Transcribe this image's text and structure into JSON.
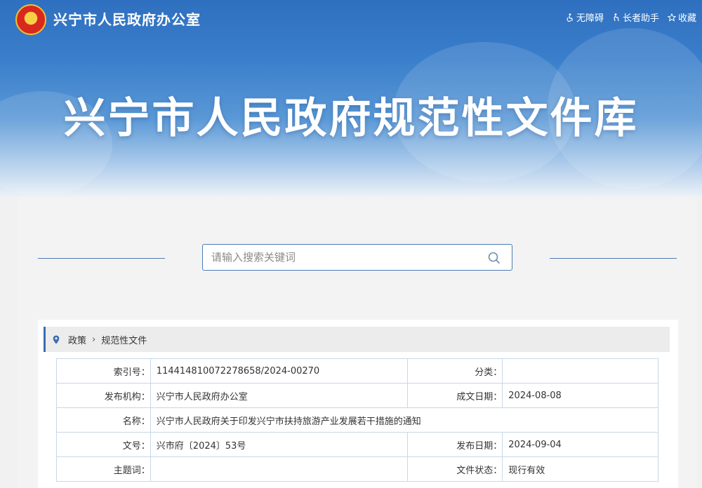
{
  "header": {
    "site_name": "兴宁市人民政府办公室",
    "banner_title": "兴宁市人民政府规范性文件库",
    "links": [
      {
        "icon": "wheelchair-icon",
        "label": "无障碍"
      },
      {
        "icon": "elder-icon",
        "label": "长者助手"
      },
      {
        "icon": "star-icon",
        "label": "收藏"
      }
    ]
  },
  "search": {
    "placeholder": "请输入搜索关键词",
    "value": ""
  },
  "breadcrumb": {
    "items": [
      "政策",
      "规范性文件"
    ]
  },
  "doc": {
    "index_no_label": "索引号：",
    "index_no": "114414810072278658/2024-00270",
    "category_label": "分类：",
    "category": "",
    "publisher_label": "发布机构：",
    "publisher": "兴宁市人民政府办公室",
    "written_date_label": "成文日期：",
    "written_date": "2024-08-08",
    "name_label": "名称：",
    "name": "兴宁市人民政府关于印发兴宁市扶持旅游产业发展若干措施的通知",
    "doc_no_label": "文号：",
    "doc_no": "兴市府〔2024〕53号",
    "pub_date_label": "发布日期：",
    "pub_date": "2024-09-04",
    "subject_label": "主题词：",
    "subject": "",
    "status_label": "文件状态：",
    "status": "现行有效"
  },
  "colors": {
    "accent": "#3a6db0",
    "banner": "#3a7fcb",
    "border": "#c6d8ea"
  }
}
